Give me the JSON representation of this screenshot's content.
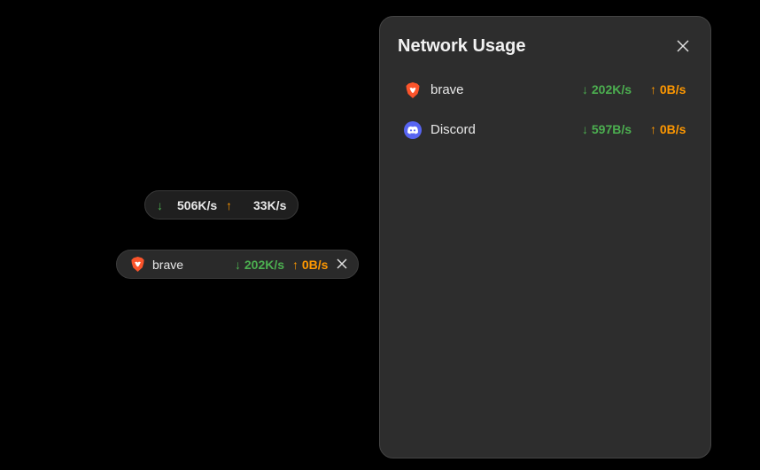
{
  "speed_widget": {
    "down_arrow": "↓",
    "down_value": "506K/s",
    "up_arrow": "↑",
    "up_value": "33K/s"
  },
  "app_widget": {
    "icon": "brave-icon",
    "name": "brave",
    "down": "↓ 202K/s",
    "up": "↑ 0B/s"
  },
  "panel": {
    "title": "Network Usage",
    "rows": [
      {
        "icon": "brave-icon",
        "name": "brave",
        "down": "↓ 202K/s",
        "up": "↑ 0B/s"
      },
      {
        "icon": "discord-icon",
        "name": "Discord",
        "down": "↓ 597B/s",
        "up": "↑ 0B/s"
      }
    ]
  },
  "colors": {
    "download": "#4caf50",
    "upload": "#ff9800",
    "panel_bg": "#2d2d2d",
    "background": "#000000"
  }
}
